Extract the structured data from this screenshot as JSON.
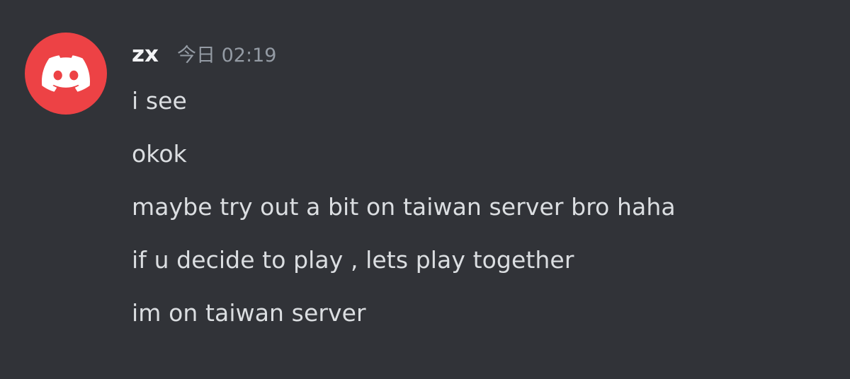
{
  "author": {
    "name": "zx",
    "avatar_icon": "discord-logo-icon",
    "avatar_color": "#ed4245"
  },
  "timestamp": "今日 02:19",
  "messages": [
    {
      "text": "i see"
    },
    {
      "text": "okok"
    },
    {
      "text": "maybe try out a bit on taiwan server bro haha"
    },
    {
      "text": "if u decide to play , lets play together"
    },
    {
      "text": "im on taiwan server"
    }
  ],
  "colors": {
    "background": "#313338",
    "username": "#f2f3f5",
    "timestamp": "#949ba4",
    "message_text": "#dbdee1"
  }
}
